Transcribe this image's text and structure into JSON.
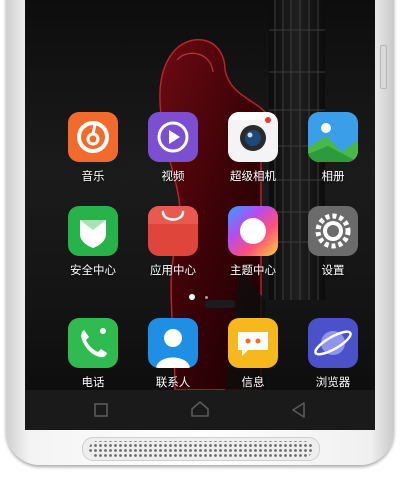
{
  "device": {
    "body_color": "#f2f2f2"
  },
  "home_screen": {
    "rows": [
      [
        {
          "label": "音乐",
          "icon": "music-icon",
          "color": "#f26b2c"
        },
        {
          "label": "视频",
          "icon": "video-play-icon",
          "color": "#7b4fcf"
        },
        {
          "label": "超级相机",
          "icon": "camera-icon",
          "color": "#f4f4f4"
        },
        {
          "label": "相册",
          "icon": "gallery-icon",
          "color": "#3a9ee8"
        }
      ],
      [
        {
          "label": "安全中心",
          "icon": "shield-icon",
          "color": "#27b24a"
        },
        {
          "label": "应用中心",
          "icon": "app-store-bag-icon",
          "color": "#e0453b"
        },
        {
          "label": "主题中心",
          "icon": "theme-icon",
          "color": "#ff9f2e"
        },
        {
          "label": "设置",
          "icon": "gear-icon",
          "color": "#6b6b6b"
        }
      ],
      [
        {
          "label": "电话",
          "icon": "phone-icon",
          "color": "#2fbb4f"
        },
        {
          "label": "联系人",
          "icon": "contacts-icon",
          "color": "#1f8fe5"
        },
        {
          "label": "信息",
          "icon": "message-icon",
          "color": "#f6b81c"
        },
        {
          "label": "浏览器",
          "icon": "browser-planet-icon",
          "color": "#4b52c9"
        }
      ]
    ],
    "pages": {
      "current": 1,
      "total": 2
    }
  },
  "navbar": {
    "buttons": [
      {
        "name": "recent-apps-icon"
      },
      {
        "name": "home-icon"
      },
      {
        "name": "back-icon"
      }
    ]
  }
}
